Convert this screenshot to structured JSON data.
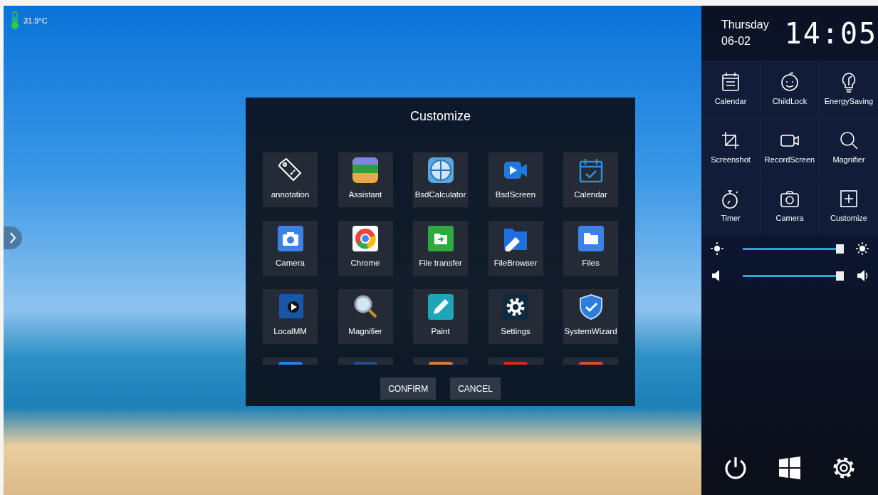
{
  "status": {
    "temperature": "31.9°C"
  },
  "dialog": {
    "title": "Customize",
    "apps": [
      {
        "label": "annotation"
      },
      {
        "label": "Assistant"
      },
      {
        "label": "BsdCalculator"
      },
      {
        "label": "BsdScreen"
      },
      {
        "label": "Calendar"
      },
      {
        "label": "Camera"
      },
      {
        "label": "Chrome"
      },
      {
        "label": "File transfer"
      },
      {
        "label": "FileBrowser"
      },
      {
        "label": "Files"
      },
      {
        "label": "LocalMM"
      },
      {
        "label": "Magnifier"
      },
      {
        "label": "Paint"
      },
      {
        "label": "Settings"
      },
      {
        "label": "SystemWizard"
      }
    ],
    "buttons": [
      {
        "label": "CONFIRM"
      },
      {
        "label": "CANCEL"
      }
    ]
  },
  "panel": {
    "day": "Thursday",
    "date": "06-02",
    "time": "14:05",
    "tiles": [
      {
        "label": "Calendar"
      },
      {
        "label": "ChildLock"
      },
      {
        "label": "EnergySaving"
      },
      {
        "label": "Screenshot"
      },
      {
        "label": "RecordScreen"
      },
      {
        "label": "Magnifier"
      },
      {
        "label": "Timer"
      },
      {
        "label": "Camera"
      },
      {
        "label": "Customize"
      }
    ],
    "sliders": [
      {
        "kind": "brightness",
        "level": 1.0
      },
      {
        "kind": "volume",
        "level": 1.0
      }
    ]
  }
}
